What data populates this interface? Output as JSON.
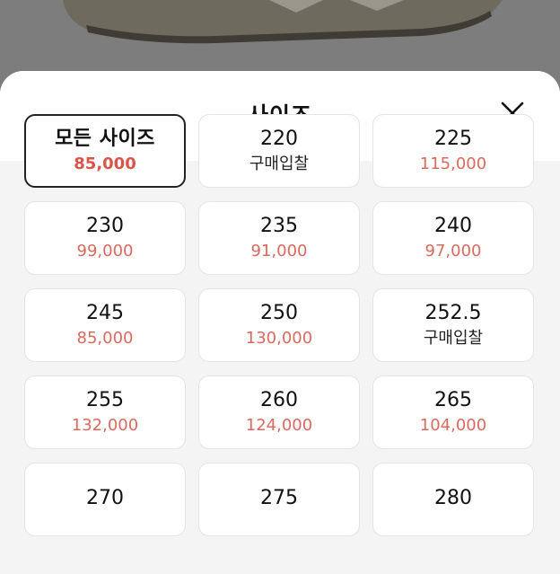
{
  "sheet": {
    "title": "사이즈",
    "close_icon": "close-icon"
  },
  "colors": {
    "price": "#d96a5e",
    "selected_border": "#222222"
  },
  "sizes": [
    {
      "size": "모든 사이즈",
      "price": "85,000",
      "selected": true
    },
    {
      "size": "220",
      "price": "구매입찰",
      "bid": true
    },
    {
      "size": "225",
      "price": "115,000"
    },
    {
      "size": "230",
      "price": "99,000"
    },
    {
      "size": "235",
      "price": "91,000"
    },
    {
      "size": "240",
      "price": "97,000"
    },
    {
      "size": "245",
      "price": "85,000"
    },
    {
      "size": "250",
      "price": "130,000"
    },
    {
      "size": "252.5",
      "price": "구매입찰",
      "bid": true
    },
    {
      "size": "255",
      "price": "132,000"
    },
    {
      "size": "260",
      "price": "124,000"
    },
    {
      "size": "265",
      "price": "104,000"
    },
    {
      "size": "270",
      "price": ""
    },
    {
      "size": "275",
      "price": ""
    },
    {
      "size": "280",
      "price": ""
    }
  ]
}
